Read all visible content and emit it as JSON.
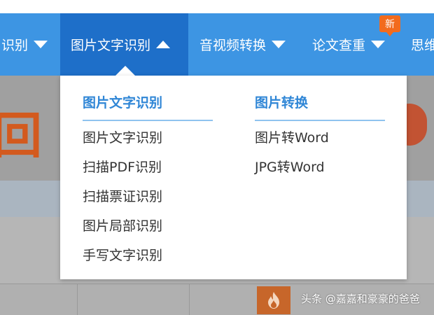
{
  "nav": {
    "items": [
      {
        "label": "识别"
      },
      {
        "label": "图片文字识别"
      },
      {
        "label": "音视频转换"
      },
      {
        "label": "论文查重",
        "badge": "新"
      },
      {
        "label": "思维"
      }
    ],
    "active_index": 1
  },
  "dropdown": {
    "columns": [
      {
        "heading": "图片文字识别",
        "links": [
          "图片文字识别",
          "扫描PDF识别",
          "扫描票证识别",
          "图片局部识别",
          "手写文字识别"
        ]
      },
      {
        "heading": "图片转换",
        "links": [
          "图片转Word",
          "JPG转Word"
        ]
      }
    ]
  },
  "background": {
    "banner_glyph": "回"
  },
  "watermark": "头条 @嘉嘉和豪豪的爸爸",
  "icons": [
    "caret-down-icon",
    "caret-up-icon",
    "fire-icon"
  ],
  "colors": {
    "nav_bg": "#3d95e3",
    "nav_active_bg": "#1e6fc9",
    "heading_blue": "#2f86d6",
    "badge_orange": "#f26b1d"
  }
}
